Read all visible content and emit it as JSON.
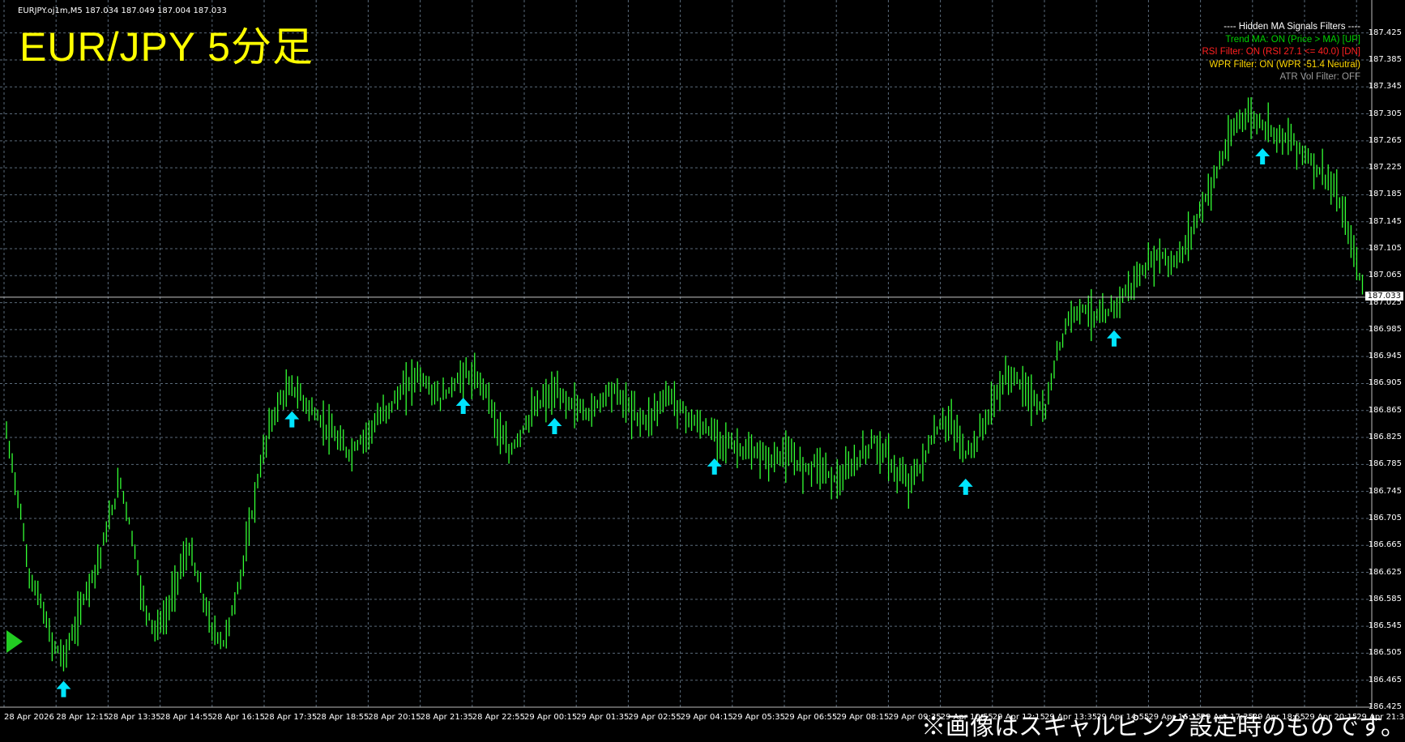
{
  "chart_info": {
    "symbol_line": "EURJPY.oj1m,M5  187.034 187.049 187.004 187.033",
    "title": "EUR/JPY 5分足",
    "current_price": "187.033"
  },
  "filters": {
    "header": "---- Hidden MA Signals Filters ----",
    "lines": [
      {
        "text": "Trend MA: ON (Price > MA) [UP]",
        "color": "#00d000"
      },
      {
        "text": "RSI Filter: ON (RSI 27.1 <= 40.0) [DN]",
        "color": "#ff2020"
      },
      {
        "text": "WPR Filter: ON (WPR -51.4 Neutral)",
        "color": "#ffd700"
      },
      {
        "text": "ATR Vol Filter: OFF",
        "color": "#9a9a9a"
      }
    ]
  },
  "footnote": "※画像はスキャルピング設定時のものです。",
  "colors": {
    "background": "#000000",
    "grid": "#5a6a7a",
    "candle": "#33ff33",
    "signal_arrow": "#00e5ff",
    "title": "#ffff00"
  },
  "chart_data": {
    "type": "line",
    "title": "EUR/JPY 5分足",
    "y_ticks": [
      "187.425",
      "187.385",
      "187.345",
      "187.305",
      "187.265",
      "187.225",
      "187.185",
      "187.145",
      "187.105",
      "187.065",
      "187.025",
      "186.985",
      "186.945",
      "186.905",
      "186.865",
      "186.825",
      "186.785",
      "186.745",
      "186.705",
      "186.665",
      "186.625",
      "186.585",
      "186.545",
      "186.505",
      "186.465",
      "186.425"
    ],
    "x_ticks": [
      "28 Apr 2026",
      "28 Apr 12:15",
      "28 Apr 13:35",
      "28 Apr 14:55",
      "28 Apr 16:15",
      "28 Apr 17:35",
      "28 Apr 18:55",
      "28 Apr 20:15",
      "28 Apr 21:35",
      "28 Apr 22:55",
      "29 Apr 00:15",
      "29 Apr 01:35",
      "29 Apr 02:55",
      "29 Apr 04:15",
      "29 Apr 05:35",
      "29 Apr 06:55",
      "29 Apr 08:15",
      "29 Apr 09:35",
      "29 Apr 10:55",
      "29 Apr 12:15",
      "29 Apr 13:35",
      "29 Apr 14:55",
      "29 Apr 16:15",
      "29 Apr 17:35",
      "29 Apr 18:55",
      "29 Apr 20:15",
      "29 Apr 21:35"
    ],
    "ylim": [
      186.425,
      187.445
    ],
    "series": [
      {
        "values": [
          186.83,
          186.74,
          186.62,
          186.58,
          186.52,
          186.5,
          186.54,
          186.6,
          186.64,
          186.7,
          186.76,
          186.68,
          186.58,
          186.54,
          186.56,
          186.62,
          186.66,
          186.6,
          186.54,
          186.52,
          186.58,
          186.66,
          186.76,
          186.84,
          186.88,
          186.9,
          186.88,
          186.86,
          186.84,
          186.82,
          186.8,
          186.82,
          186.84,
          186.86,
          186.88,
          186.9,
          186.92,
          186.9,
          186.88,
          186.9,
          186.92,
          186.91,
          186.9,
          186.84,
          186.8,
          186.83,
          186.86,
          186.88,
          186.89,
          186.88,
          186.87,
          186.86,
          186.88,
          186.9,
          186.88,
          186.86,
          186.85,
          186.87,
          186.89,
          186.87,
          186.85,
          186.84,
          186.83,
          186.82,
          186.81,
          186.8,
          186.8,
          186.79,
          186.8,
          186.79,
          186.78,
          186.79,
          186.77,
          186.76,
          186.78,
          186.8,
          186.82,
          186.8,
          186.77,
          186.76,
          186.78,
          186.82,
          186.85,
          186.84,
          186.8,
          186.82,
          186.86,
          186.9,
          186.92,
          186.9,
          186.88,
          186.86,
          186.95,
          187.0,
          187.02,
          187.01,
          187.0,
          187.02,
          187.04,
          187.06,
          187.08,
          187.1,
          187.08,
          187.1,
          187.14,
          187.18,
          187.22,
          187.26,
          187.3,
          187.3,
          187.29,
          187.28,
          187.27,
          187.26,
          187.24,
          187.22,
          187.2,
          187.16,
          187.1,
          187.03
        ]
      }
    ]
  },
  "signals": [
    {
      "label": "buy-arrow",
      "index": 5
    },
    {
      "label": "buy-arrow",
      "index": 25
    },
    {
      "label": "buy-arrow",
      "index": 40
    },
    {
      "label": "buy-arrow",
      "index": 48
    },
    {
      "label": "buy-arrow",
      "index": 62
    },
    {
      "label": "buy-arrow",
      "index": 84
    },
    {
      "label": "buy-arrow",
      "index": 97
    },
    {
      "label": "buy-arrow",
      "index": 110
    }
  ]
}
